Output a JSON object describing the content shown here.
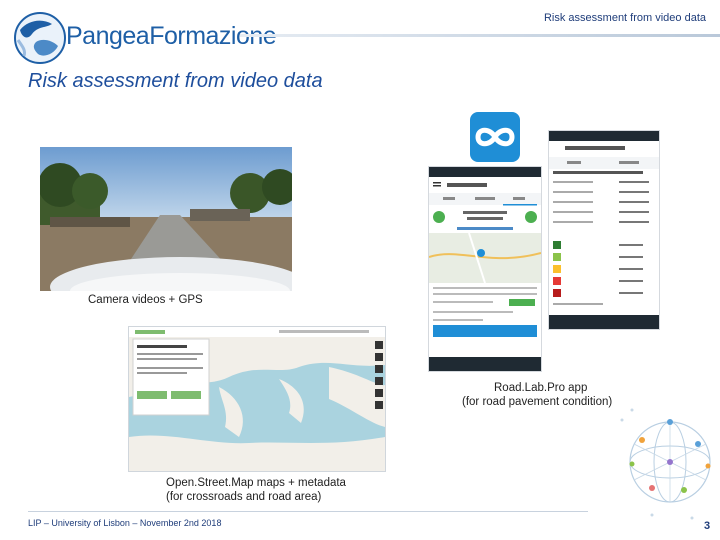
{
  "header": {
    "logo_text": "PangeaFormazione",
    "running_title": "Risk assessment from video data"
  },
  "slide": {
    "title": "Risk assessment from video data"
  },
  "captions": {
    "camera": "Camera videos + GPS",
    "roadlab_line1": "Road.Lab.Pro app",
    "roadlab_line2": "(for road pavement condition)",
    "osm_line1": "Open.Street.Map maps + metadata",
    "osm_line2": "(for crossroads and road area)"
  },
  "footer": {
    "text": "LIP – University of Lisbon – November 2nd 2018",
    "page_number": "3"
  }
}
